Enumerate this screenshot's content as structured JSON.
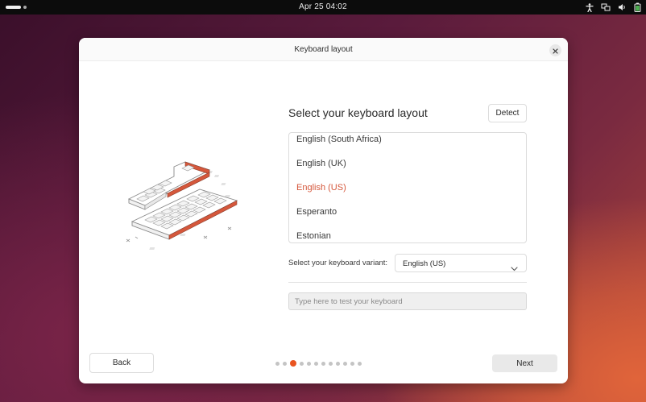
{
  "topbar": {
    "clock": "Apr 25  04:02",
    "tray_icons": [
      "accessibility-icon",
      "network-icon",
      "volume-icon",
      "battery-icon"
    ]
  },
  "dialog": {
    "title": "Keyboard layout",
    "heading": "Select your keyboard layout",
    "detect_label": "Detect",
    "layouts": [
      {
        "label": "English (South Africa)",
        "selected": false
      },
      {
        "label": "English (UK)",
        "selected": false
      },
      {
        "label": "English (US)",
        "selected": true
      },
      {
        "label": "Esperanto",
        "selected": false
      },
      {
        "label": "Estonian",
        "selected": false
      }
    ],
    "variant_label": "Select your keyboard variant:",
    "variant_value": "English (US)",
    "test_placeholder": "Type here to test your keyboard",
    "back_label": "Back",
    "next_label": "Next",
    "progress": {
      "total_steps": 12,
      "current_step": 3
    }
  },
  "colors": {
    "accent": "#e95420",
    "selected_text": "#d5573b"
  }
}
